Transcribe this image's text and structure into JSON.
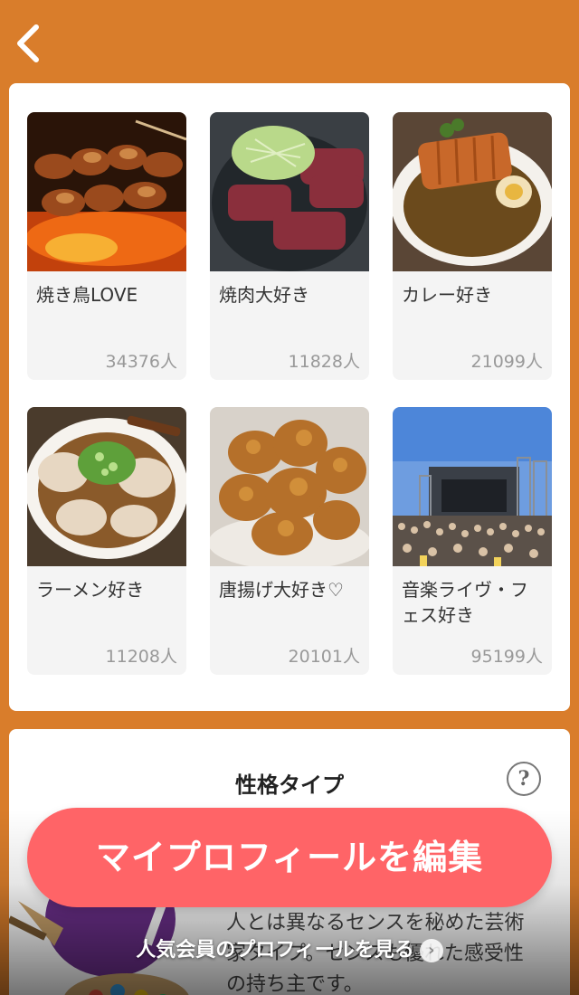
{
  "header": {
    "back_icon": "chevron-left-icon"
  },
  "interests": [
    {
      "label": "焼き鳥LOVE",
      "count": "34376人"
    },
    {
      "label": "焼肉大好き",
      "count": "11828人"
    },
    {
      "label": "カレー好き",
      "count": "21099人"
    },
    {
      "label": "ラーメン好き",
      "count": "11208人"
    },
    {
      "label": "唐揚げ大好き♡",
      "count": "20101人"
    },
    {
      "label": "音楽ライヴ・フェス好き",
      "count": "95199人"
    }
  ],
  "personality": {
    "title": "性格タイプ",
    "help": "?",
    "description": "人とは異なるセンスを秘めた芸術家タイプ。センスも優れた感受性の持ち主です。"
  },
  "edit_button": "マイプロフィールを編集",
  "popular_link": "人気会員のプロフィールを見る",
  "colors": {
    "background": "#d97d2b",
    "accent": "#ff6467"
  }
}
